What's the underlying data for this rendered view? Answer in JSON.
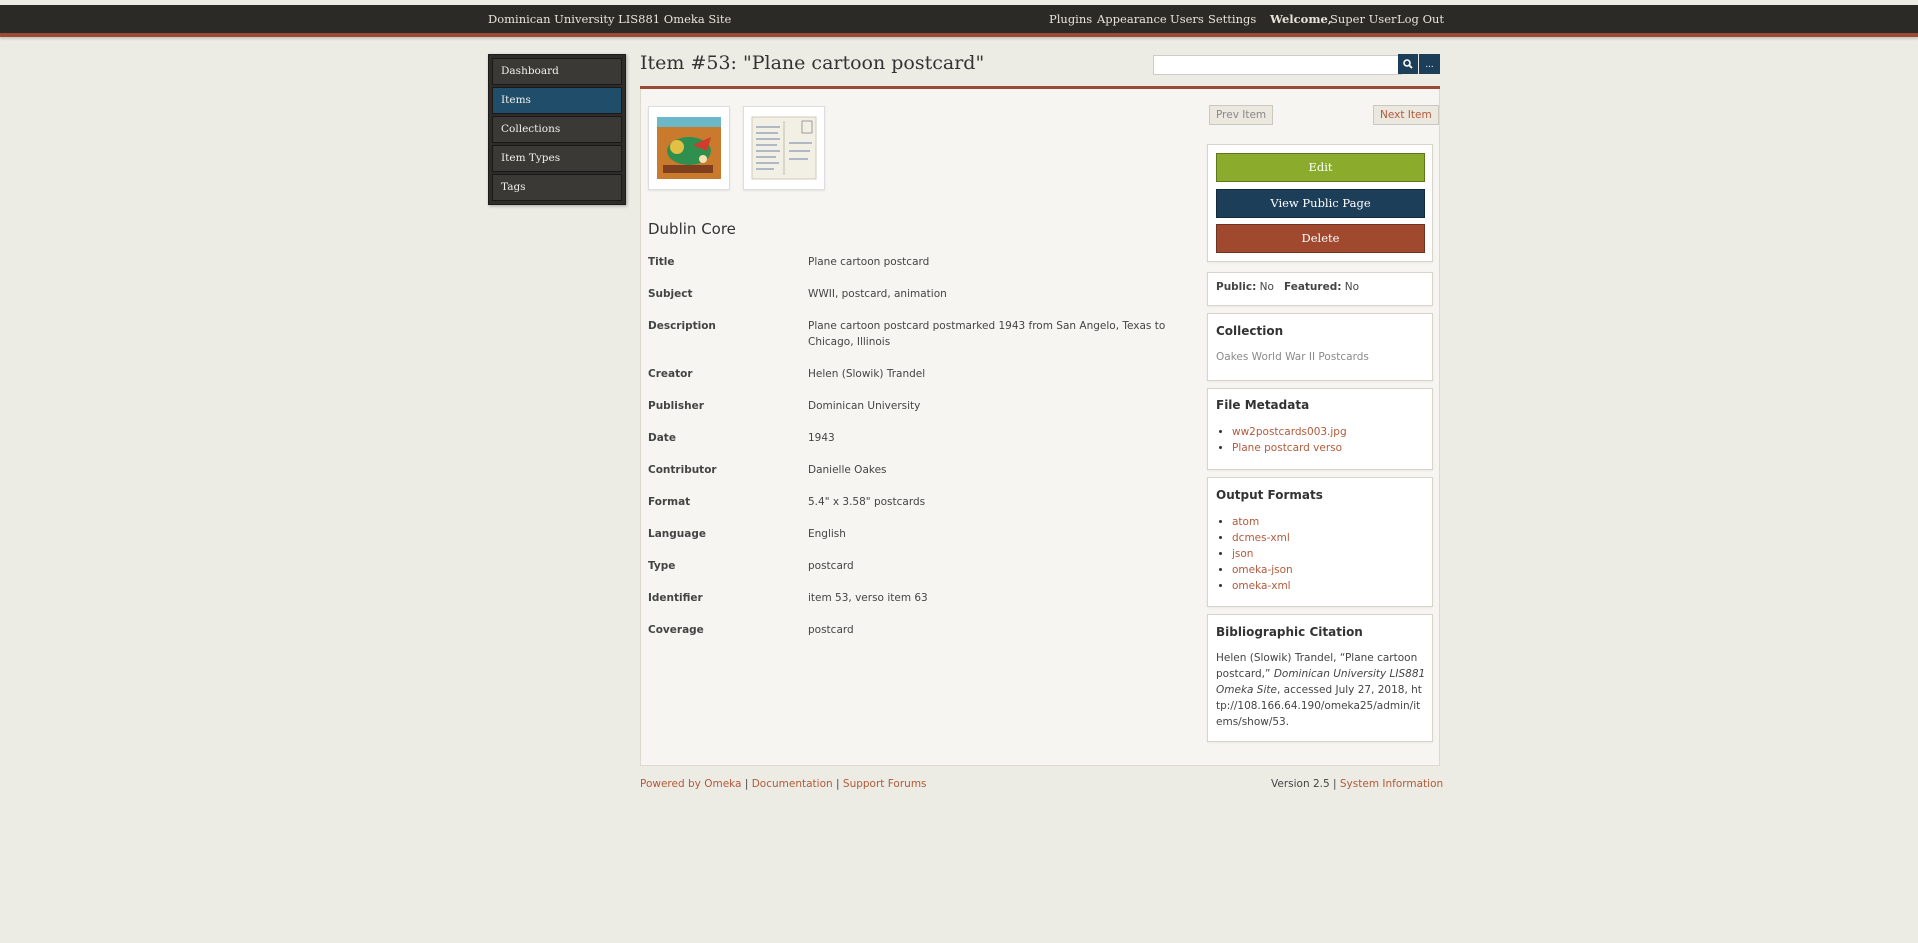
{
  "header": {
    "site_title": "Dominican University LIS881 Omeka Site",
    "nav": [
      "Plugins",
      "Appearance",
      "Users",
      "Settings"
    ],
    "welcome_label": "Welcome,",
    "user_name": "Super User",
    "logout": "Log Out"
  },
  "sidebar": {
    "items": [
      {
        "label": "Dashboard"
      },
      {
        "label": "Items"
      },
      {
        "label": "Collections"
      },
      {
        "label": "Item Types"
      },
      {
        "label": "Tags"
      }
    ],
    "active": "Items"
  },
  "page": {
    "title": "Item #53: \"Plane cartoon postcard\""
  },
  "search": {
    "placeholder": "",
    "submit_icon": "search-icon",
    "advanced_label": "..."
  },
  "item": {
    "images": [
      {
        "alt": "postcard front thumbnail",
        "icon": "image-thumbnail"
      },
      {
        "alt": "postcard verso thumbnail",
        "icon": "image-thumbnail"
      }
    ],
    "section_title": "Dublin Core",
    "metadata": [
      {
        "label": "Title",
        "value": "Plane cartoon postcard"
      },
      {
        "label": "Subject",
        "value": "WWII, postcard, animation"
      },
      {
        "label": "Description",
        "value": "Plane cartoon postcard postmarked 1943 from San Angelo, Texas to Chicago, Illinois"
      },
      {
        "label": "Creator",
        "value": "Helen (Slowik) Trandel"
      },
      {
        "label": "Publisher",
        "value": "Dominican University"
      },
      {
        "label": "Date",
        "value": "1943"
      },
      {
        "label": "Contributor",
        "value": "Danielle Oakes"
      },
      {
        "label": "Format",
        "value": "5.4\" x 3.58\" postcards"
      },
      {
        "label": "Language",
        "value": "English"
      },
      {
        "label": "Type",
        "value": "postcard"
      },
      {
        "label": "Identifier",
        "value": "item 53, verso item 63"
      },
      {
        "label": "Coverage",
        "value": "postcard"
      }
    ]
  },
  "pager": {
    "prev": "Prev Item",
    "next": "Next Item"
  },
  "actions": {
    "edit": "Edit",
    "view_public": "View Public Page",
    "delete": "Delete"
  },
  "status": {
    "public_label": "Public:",
    "public_value": "No",
    "featured_label": "Featured:",
    "featured_value": "No"
  },
  "collection": {
    "heading": "Collection",
    "value": "Oakes World War II Postcards"
  },
  "file_metadata": {
    "heading": "File Metadata",
    "files": [
      "ww2postcards003.jpg",
      "Plane postcard verso"
    ]
  },
  "output_formats": {
    "heading": "Output Formats",
    "formats": [
      "atom",
      "dcmes-xml",
      "json",
      "omeka-json",
      "omeka-xml"
    ]
  },
  "citation": {
    "heading": "Bibliographic Citation",
    "part1": "Helen (Slowik) Trandel, “Plane cartoon postcard,”",
    "site_italic": "Dominican University LIS881 Omeka Site",
    "part2": ", accessed July 27, 2018, http://108.166.64.190/omeka25/admin/items/show/53."
  },
  "footer": {
    "powered_by": "Powered by Omeka",
    "documentation": "Documentation",
    "support": "Support Forums",
    "version": "Version 2.5",
    "system_info": "System Information",
    "separator": "|"
  },
  "colors": {
    "topbar": "#2c2a26",
    "accent_rule": "#9a4b35",
    "active_nav": "#1f4d6a",
    "edit_btn": "#8aab2c",
    "view_btn": "#1c3e58",
    "delete_btn": "#a1492f",
    "link": "#b25a3a"
  }
}
